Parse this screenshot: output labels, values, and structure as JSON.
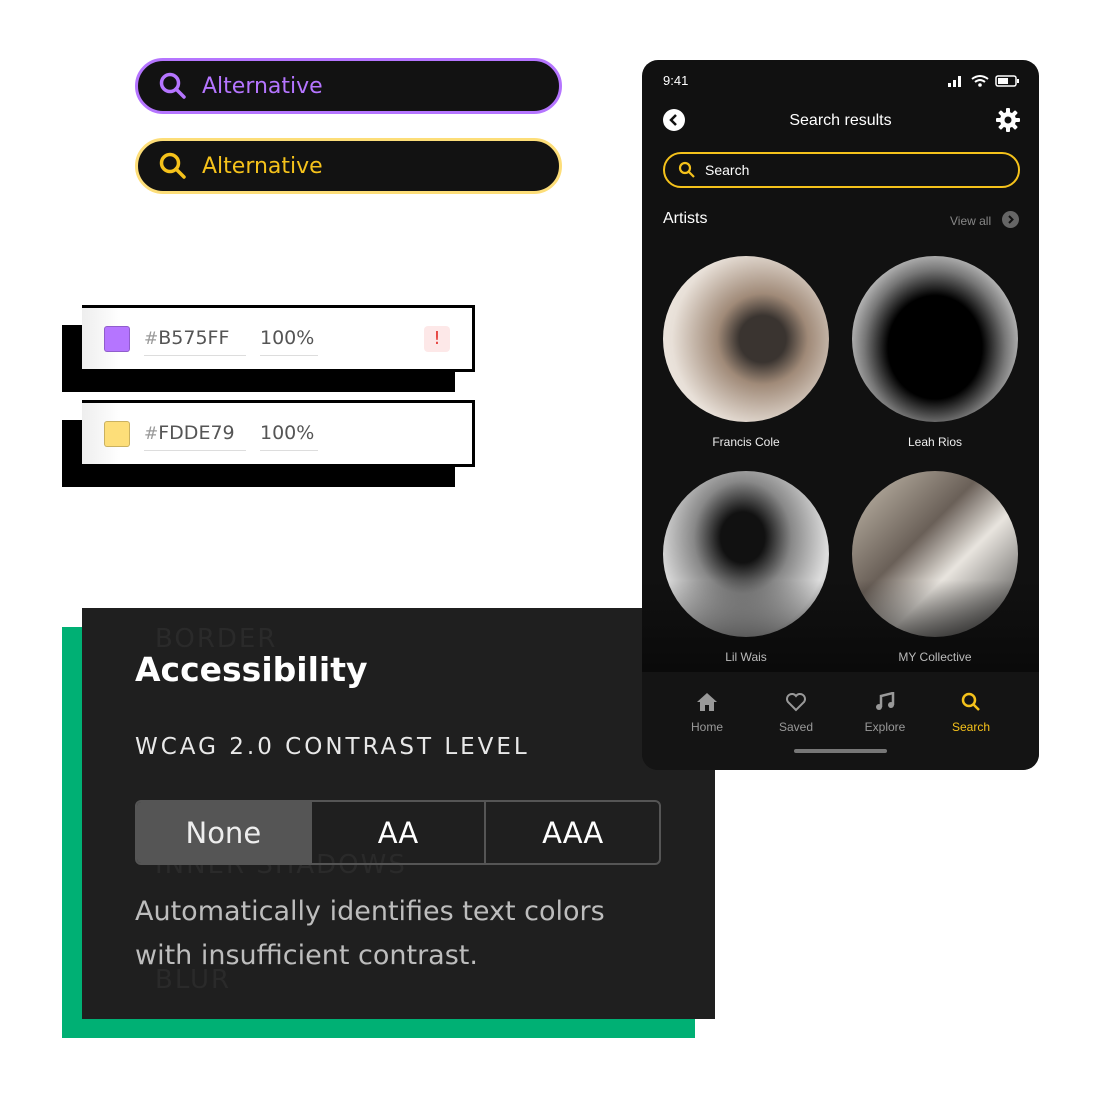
{
  "search_bars": [
    {
      "text": "Alternative",
      "color": "#B575FF",
      "icon": "search-icon"
    },
    {
      "text": "Alternative",
      "color": "#FDDE79",
      "text_color": "#F5C21B",
      "icon": "search-icon"
    }
  ],
  "color_rows": [
    {
      "hash": "#",
      "hex": "B575FF",
      "opacity": "100%",
      "swatch": "#B575FF",
      "warning": "!"
    },
    {
      "hash": "#",
      "hex": "FDDE79",
      "opacity": "100%",
      "swatch": "#FDDE79"
    }
  ],
  "accessibility": {
    "title": "Accessibility",
    "subtitle": "WCAG 2.0 CONTRAST LEVEL",
    "options": [
      "None",
      "AA",
      "AAA"
    ],
    "selected": "None",
    "description_line1": "Automatically identifies text colors",
    "description_line2": "with insufficient contrast.",
    "ghost_labels": [
      "BORDER",
      "INNER SHADOWS",
      "BLUR"
    ],
    "accent": "#00B074"
  },
  "phone": {
    "time": "9:41",
    "title": "Search results",
    "search_placeholder": "Search",
    "section": "Artists",
    "view_all": "View all",
    "artists": [
      "Francis Cole",
      "Leah Rios",
      "Lil Wais",
      "MY Collective"
    ],
    "nav": [
      {
        "label": "Home",
        "icon": "home-icon"
      },
      {
        "label": "Saved",
        "icon": "heart-icon"
      },
      {
        "label": "Explore",
        "icon": "music-note-icon"
      },
      {
        "label": "Search",
        "icon": "search-icon",
        "active": true
      }
    ],
    "accent": "#F5C21B"
  }
}
